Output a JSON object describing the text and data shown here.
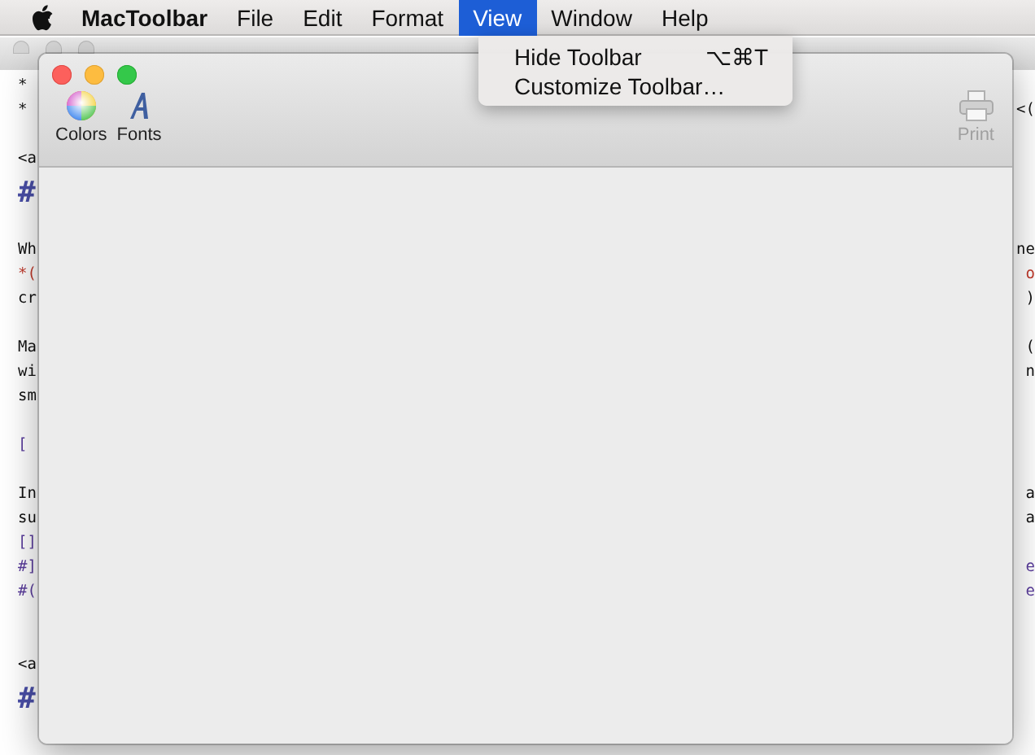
{
  "menu_bar": {
    "app_name": "MacToolbar",
    "items": [
      {
        "label": "File",
        "selected": false
      },
      {
        "label": "Edit",
        "selected": false
      },
      {
        "label": "Format",
        "selected": false
      },
      {
        "label": "View",
        "selected": true
      },
      {
        "label": "Window",
        "selected": false
      },
      {
        "label": "Help",
        "selected": false
      }
    ]
  },
  "view_menu": {
    "items": [
      {
        "label": "Hide Toolbar",
        "shortcut": "⌥⌘T"
      },
      {
        "label": "Customize Toolbar…"
      }
    ]
  },
  "background_window": {
    "lines": [
      {
        "kind": "text",
        "left": "*"
      },
      {
        "kind": "text",
        "left": "*",
        "right": "<("
      },
      {
        "kind": "blank"
      },
      {
        "kind": "text",
        "left": "<a"
      },
      {
        "kind": "heading",
        "left": "#"
      },
      {
        "kind": "blank"
      },
      {
        "kind": "text",
        "left": "Wh",
        "right": "ne"
      },
      {
        "kind": "emphasis",
        "left": "*(",
        "right": "o"
      },
      {
        "kind": "text",
        "left": "cr",
        "right": ")"
      },
      {
        "kind": "blank"
      },
      {
        "kind": "text",
        "left": "Ma",
        "right": "("
      },
      {
        "kind": "text",
        "left": "wi",
        "right": "n"
      },
      {
        "kind": "text",
        "left": "sm"
      },
      {
        "kind": "blank"
      },
      {
        "kind": "link",
        "left": "["
      },
      {
        "kind": "blank"
      },
      {
        "kind": "text",
        "left": "In",
        "right": "a"
      },
      {
        "kind": "text",
        "left": "su",
        "right": "a"
      },
      {
        "kind": "link",
        "left": "[]"
      },
      {
        "kind": "link",
        "left": "#]",
        "right": "e"
      },
      {
        "kind": "link",
        "left": "#(",
        "right": "e"
      },
      {
        "kind": "blank"
      },
      {
        "kind": "blank"
      },
      {
        "kind": "text",
        "left": "<a"
      },
      {
        "kind": "heading",
        "left": "#"
      }
    ]
  },
  "document_window": {
    "toolbar": [
      {
        "kind": "colors",
        "label": "Colors",
        "disabled": false
      },
      {
        "kind": "fonts",
        "label": "Fonts",
        "disabled": false
      },
      {
        "kind": "spacer"
      },
      {
        "kind": "print",
        "label": "Print",
        "disabled": true
      }
    ]
  }
}
